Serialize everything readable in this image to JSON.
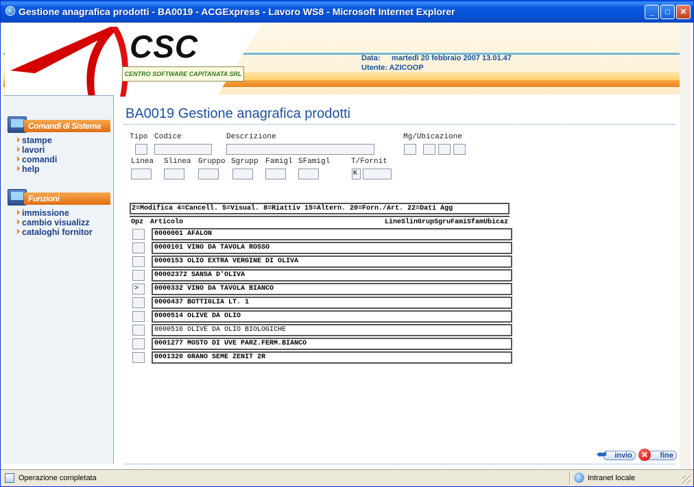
{
  "window": {
    "title": "Gestione anagrafica prodotti - BA0019 - ACGExpress - Lavoro WS8 - Microsoft Internet Explorer",
    "min_label": "_",
    "max_label": "□",
    "close_label": "✕"
  },
  "header": {
    "logo_text": "CSC",
    "logo_subtitle": "CENTRO SOFTWARE CAPITANATA SRL",
    "data_label": "Data:",
    "data_value": "martedì 20 febbraio 2007 13.01.47",
    "utente_label": "Utente:",
    "utente_value": "AZICOOP"
  },
  "sidebar": {
    "section1_title": "Comandi di Sistema",
    "section1_items": [
      "stampe",
      "lavori",
      "comandi",
      "help"
    ],
    "section2_title": "Funzioni",
    "section2_items": [
      "immissione",
      "cambio visualizz",
      "cataloghi fornitor"
    ]
  },
  "main": {
    "page_title": "BA0019 Gestione anagrafica prodotti",
    "filters": {
      "tipo": "Tipo",
      "codice": "Codice",
      "descrizione": "Descrizione",
      "mg_ubicazione": "Mg/Ubicazione",
      "linea": "Linea",
      "slinea": "Slinea",
      "gruppo": "Gruppo",
      "sgrupp": "Sgrupp",
      "famigl": "Famigl",
      "sfamigl": "SFamigl",
      "t_fornit": "T/Fornit",
      "t_fornit_value": "K"
    },
    "options_legend": "2=Modifica 4=Cancell. 5=Visual. 8=Riattiv 15=Altern. 20=Forn./Art. 22=Dati Agg",
    "columns": {
      "opz": "Opz",
      "articolo": "Articolo",
      "rest": "LineSlinGrupSgruFamiSfamUbicaz"
    },
    "rows": [
      {
        "opz": "",
        "articolo": "0000001 AFALON"
      },
      {
        "opz": "",
        "articolo": "0000101 VINO DA TAVOLA ROSSO"
      },
      {
        "opz": "",
        "articolo": "0000153 OLIO EXTRA VERGINE DI OLIVA"
      },
      {
        "opz": "",
        "articolo": "00002372 SANSA D'OLIVA"
      },
      {
        "opz": ">",
        "articolo": "0000332 VINO DA TAVOLA BIANCO"
      },
      {
        "opz": "",
        "articolo": "0000437 BOTTIGLIA LT. 1"
      },
      {
        "opz": "",
        "articolo": "0000514 OLIVE DA OLIO"
      },
      {
        "opz": "",
        "articolo": "0000516 OLIVE DA OLIO BIOLOGICHE"
      },
      {
        "opz": "",
        "articolo": "0001277 MOSTO DI UVE PARZ.FERM.BIANCO"
      },
      {
        "opz": "",
        "articolo": "0001320 GRANO SEME ZENIT 2R"
      }
    ],
    "buttons": {
      "invio": "invio",
      "fine": "fine"
    }
  },
  "statusbar": {
    "text": "Operazione completata",
    "zone": "Intranet locale"
  },
  "colors": {
    "title_blue": "#1e4fa0",
    "accent_orange": "#e06d12",
    "xp_titlebar": "#0652d6"
  }
}
